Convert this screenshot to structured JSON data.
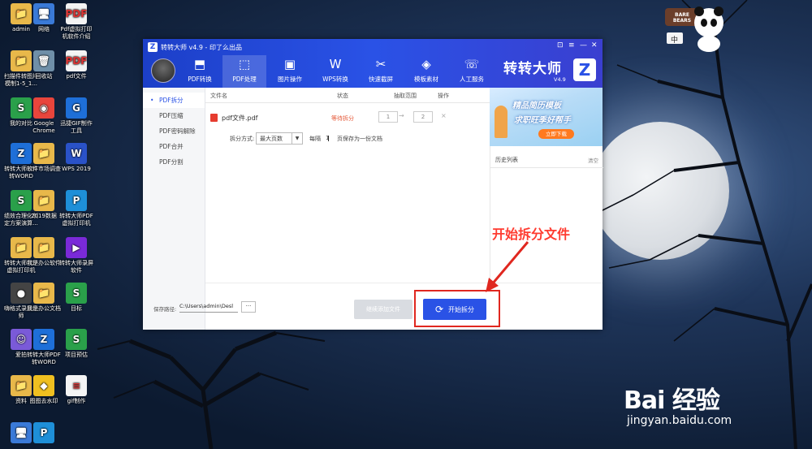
{
  "desktop": {
    "icons": [
      {
        "label": "admin",
        "color": "#e8b84a",
        "glyph": "📁"
      },
      {
        "label": "网络",
        "color": "#3a7ad8",
        "glyph": "🖥"
      },
      {
        "label": "Pdf虚拟打印机软件介绍",
        "color": "#f4f4f4",
        "glyph": "PDF"
      },
      {
        "label": "扫描件转图片模制1-5_1...",
        "color": "#e8b84a",
        "glyph": "📁"
      },
      {
        "label": "回收站",
        "color": "#6f8fa8",
        "glyph": "🗑"
      },
      {
        "label": "pdf文件",
        "color": "#f4f4f4",
        "glyph": "PDF"
      },
      {
        "label": "我的对比",
        "color": "#2aa04a",
        "glyph": "S"
      },
      {
        "label": "Google Chrome",
        "color": "#e8453c",
        "glyph": "◉"
      },
      {
        "label": "迅捷GIF制作工具",
        "color": "#1e6fd8",
        "glyph": "G"
      },
      {
        "label": "转转大师PDF转WORD",
        "color": "#1e6fd8",
        "glyph": "Z"
      },
      {
        "label": "软件市场调查",
        "color": "#e8b84a",
        "glyph": "📁"
      },
      {
        "label": "WPS 2019",
        "color": "#2a52c8",
        "glyph": "W"
      },
      {
        "label": "绩效合理化制定方案演算...",
        "color": "#2aa04a",
        "glyph": "S"
      },
      {
        "label": "2019数据",
        "color": "#e8b84a",
        "glyph": "📁"
      },
      {
        "label": "转转大师PDF虚拟打印机",
        "color": "#1e8fd8",
        "glyph": "P"
      },
      {
        "label": "转转大师PDF虚拟打印机",
        "color": "#e8b84a",
        "glyph": "📁"
      },
      {
        "label": "我是办公软件",
        "color": "#e8b84a",
        "glyph": "📁"
      },
      {
        "label": "转转大师录屏软件",
        "color": "#7a2ad8",
        "glyph": "▶"
      },
      {
        "label": "嗨格式录屏大师",
        "color": "#444",
        "glyph": "●"
      },
      {
        "label": "我是办公文档",
        "color": "#e8b84a",
        "glyph": "📁"
      },
      {
        "label": "目标",
        "color": "#2aa04a",
        "glyph": "S"
      },
      {
        "label": "爱拍",
        "color": "#7a5ad8",
        "glyph": "☺"
      },
      {
        "label": "转转大师PDF转WORD",
        "color": "#1e6fd8",
        "glyph": "Z"
      },
      {
        "label": "项目预估",
        "color": "#2aa04a",
        "glyph": "S"
      },
      {
        "label": "资料",
        "color": "#e8b84a",
        "glyph": "📁"
      },
      {
        "label": "图图去水印",
        "color": "#f0c020",
        "glyph": "◆"
      },
      {
        "label": "gif制作",
        "color": "#f4f4f4",
        "glyph": "≡"
      },
      {
        "label": "",
        "color": "#3a7ad8",
        "glyph": "🖥"
      },
      {
        "label": "",
        "color": "#1e8fd8",
        "glyph": "P"
      }
    ]
  },
  "app": {
    "title": "转转大师 v4.9 - 印了么出品",
    "logo_letter": "Z",
    "brand": "转转大师",
    "brand_letter": "Z",
    "version": "V4.9",
    "window_controls": {
      "skin": "⊡",
      "menu": "≡",
      "min": "—",
      "close": "✕"
    },
    "nav": [
      {
        "label": "PDF转换",
        "icon": "⬒"
      },
      {
        "label": "PDF处理",
        "icon": "⬚"
      },
      {
        "label": "图片操作",
        "icon": "▣"
      },
      {
        "label": "WPS转换",
        "icon": "W"
      },
      {
        "label": "快速截屏",
        "icon": "✂"
      },
      {
        "label": "模板素材",
        "icon": "◈"
      },
      {
        "label": "人工服务",
        "icon": "☏"
      }
    ],
    "sidebar": [
      {
        "label": "PDF拆分"
      },
      {
        "label": "PDF压缩"
      },
      {
        "label": "PDF密码解除"
      },
      {
        "label": "PDF合并"
      },
      {
        "label": "PDF分割"
      }
    ],
    "table": {
      "headers": {
        "name": "文件名",
        "status": "状态",
        "range": "抽取范围",
        "action": "操作"
      },
      "file": {
        "name": "pdf文件.pdf",
        "status": "等待拆分",
        "from": "1",
        "arrow": "→",
        "to": "2",
        "remove": "×"
      }
    },
    "options": {
      "mode_label": "拆分方式:",
      "mode_value": "最大页数",
      "every_label": "每隔",
      "every_value": "1",
      "every_suffix": "页保存为一份文档"
    },
    "ad": {
      "line1": "精品简历模板",
      "line2": "求职旺季好帮手",
      "button": "立即下载"
    },
    "history": {
      "title": "历史列表",
      "clear": "清空"
    },
    "bottom": {
      "save_label": "保存路径:",
      "save_path": "C:\\Users\\admin\\Desl",
      "browse": "···",
      "add_files": "继续添加文件",
      "start_icon": "⟳",
      "start": "开始拆分"
    }
  },
  "annotation": {
    "text": "开始拆分文件"
  },
  "watermark": {
    "logo": "Bai 经验",
    "url": "jingyan.baidu.com"
  },
  "widget": {
    "badge": "BARE BEARS",
    "lang": "中"
  }
}
